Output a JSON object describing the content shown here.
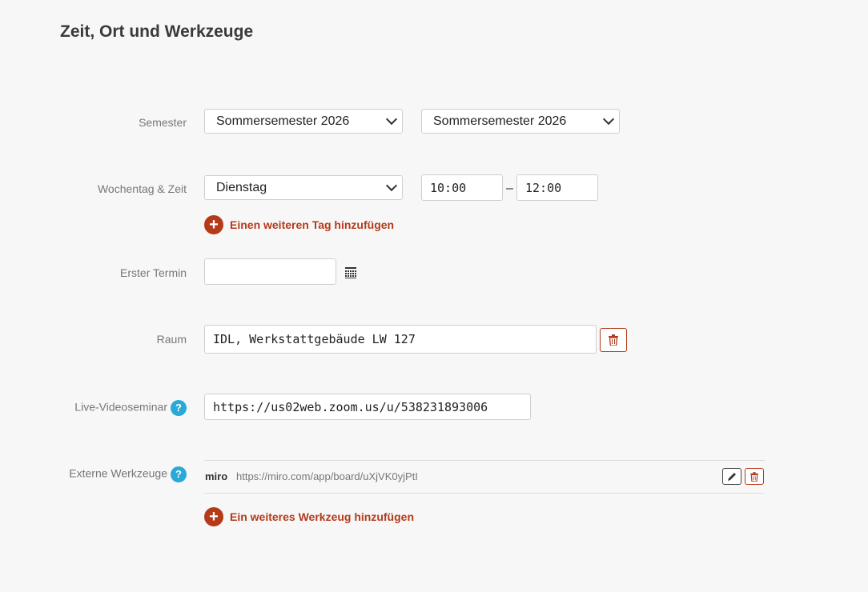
{
  "page": {
    "title": "Zeit, Ort und Werkzeuge"
  },
  "semester": {
    "label": "Semester",
    "start": "Sommersemester 2026",
    "end": "Sommersemester 2026"
  },
  "schedule": {
    "label": "Wochentag & Zeit",
    "weekday": "Dienstag",
    "time_start": "10:00",
    "separator": "–",
    "time_end": "12:00",
    "add_day": "Einen weiteren Tag hinzufügen"
  },
  "first_date": {
    "label": "Erster Termin",
    "value": ""
  },
  "room": {
    "label": "Raum",
    "value": "IDL, Werkstattgebäude LW 127"
  },
  "video": {
    "label": "Live-Videoseminar",
    "help": "?",
    "value": "https://us02web.zoom.us/u/538231893006"
  },
  "tools": {
    "label": "Externe Werkzeuge",
    "help": "?",
    "items": [
      {
        "name": "miro",
        "url": "https://miro.com/app/board/uXjVK0yjPtI"
      }
    ],
    "add_tool": "Ein weiteres Werkzeug hinzufügen"
  },
  "colors": {
    "accent": "#b43a1a",
    "help": "#29a9d8",
    "background": "#f7f7f7"
  }
}
